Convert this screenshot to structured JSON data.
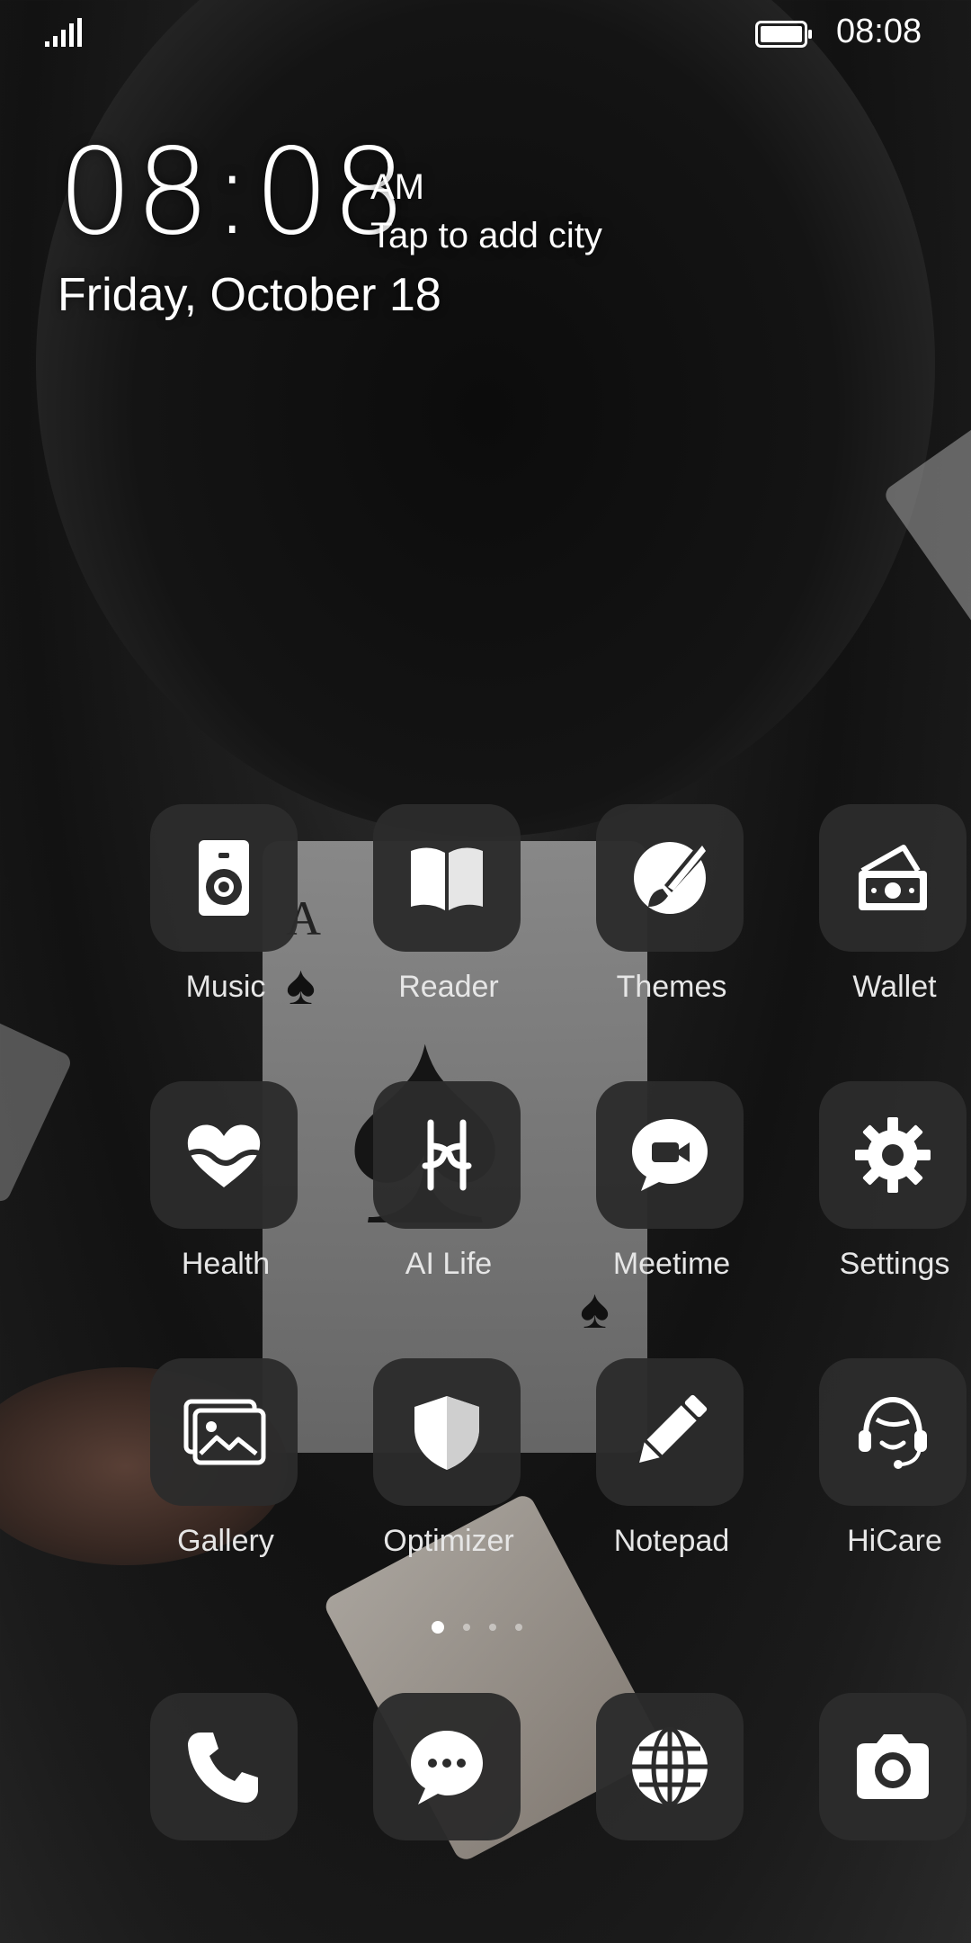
{
  "status_bar": {
    "time": "08:08",
    "signal_icon": "signal-icon",
    "battery_icon": "battery-icon"
  },
  "clock_widget": {
    "time": "08:08",
    "ampm": "AM",
    "city_prompt": "Tap to add city",
    "date": "Friday, October 18"
  },
  "apps": [
    {
      "label": "Music",
      "icon": "music-speaker-icon"
    },
    {
      "label": "Reader",
      "icon": "book-icon"
    },
    {
      "label": "Themes",
      "icon": "paintbrush-icon"
    },
    {
      "label": "Wallet",
      "icon": "wallet-icon"
    },
    {
      "label": "Health",
      "icon": "heart-icon"
    },
    {
      "label": "AI Life",
      "icon": "ai-life-icon"
    },
    {
      "label": "Meetime",
      "icon": "video-chat-icon"
    },
    {
      "label": "Settings",
      "icon": "gear-icon"
    },
    {
      "label": "Gallery",
      "icon": "gallery-icon"
    },
    {
      "label": "Optimizer",
      "icon": "shield-icon"
    },
    {
      "label": "Notepad",
      "icon": "pencil-icon"
    },
    {
      "label": "HiCare",
      "icon": "headset-icon"
    }
  ],
  "page_indicator": {
    "pages": 4,
    "current": 1
  },
  "dock": [
    {
      "icon": "phone-icon"
    },
    {
      "icon": "message-icon"
    },
    {
      "icon": "globe-icon"
    },
    {
      "icon": "camera-icon"
    }
  ]
}
